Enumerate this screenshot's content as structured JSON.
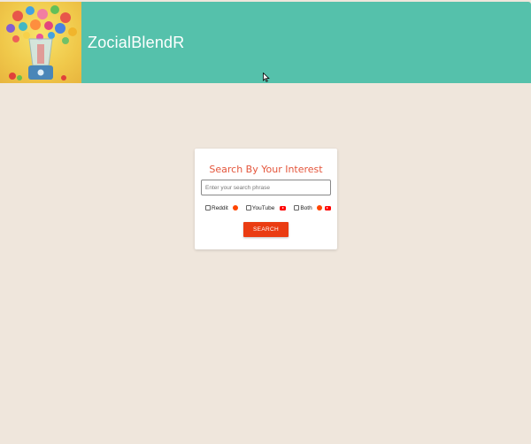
{
  "header": {
    "brand": "ZocialBlendR",
    "background": "#55c1ab",
    "logo_icon": "social-blender-logo"
  },
  "search_card": {
    "title": "Search By Your Interest",
    "input_placeholder": "Enter your search phrase",
    "input_value": "",
    "options": [
      {
        "label": "Reddit",
        "checked": false,
        "icons": [
          "reddit-icon"
        ]
      },
      {
        "label": "YouTube",
        "checked": false,
        "icons": [
          "youtube-icon"
        ]
      },
      {
        "label": "Both",
        "checked": false,
        "icons": [
          "reddit-icon",
          "youtube-icon"
        ]
      }
    ],
    "button_label": "SEARCH",
    "accent": "#ea3c12",
    "title_color": "#e4553b"
  },
  "page": {
    "background": "#efe6dc"
  }
}
